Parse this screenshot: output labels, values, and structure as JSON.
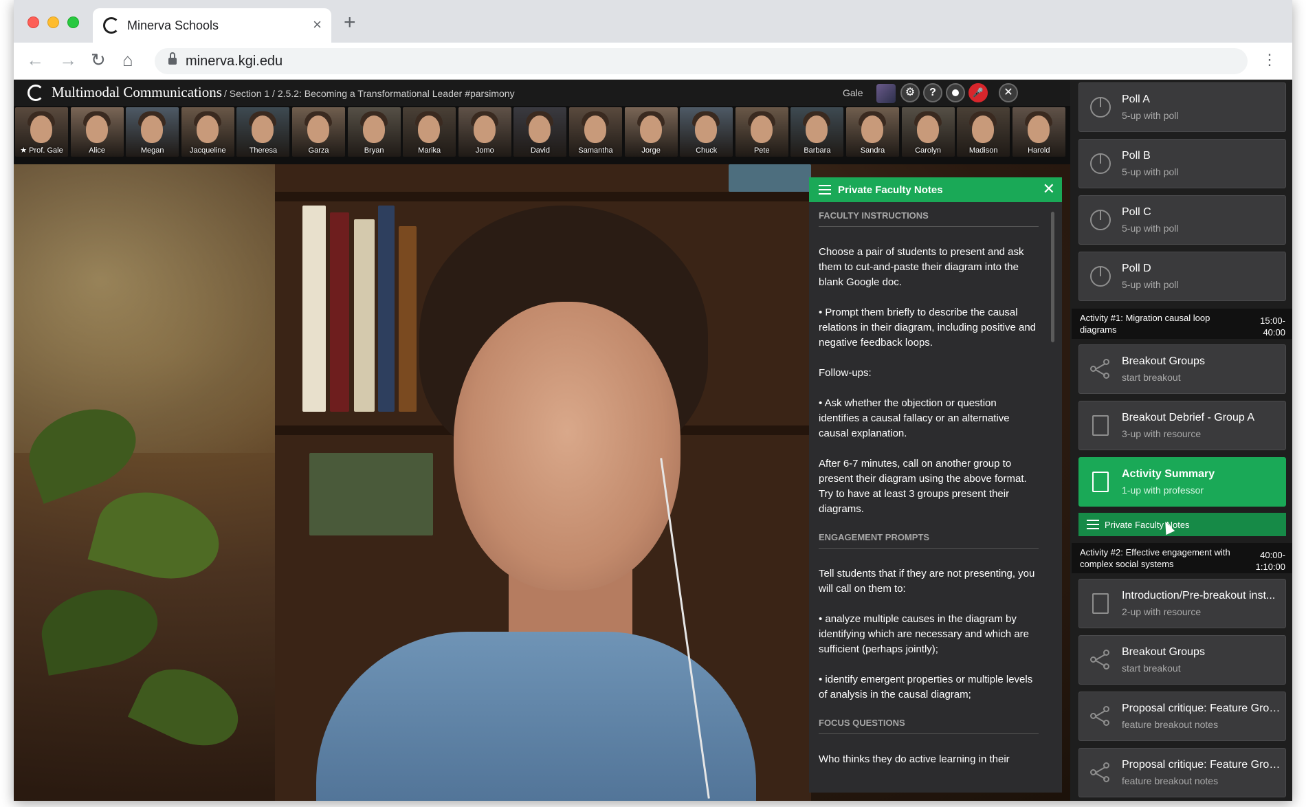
{
  "browser": {
    "tab_title": "Minerva Schools",
    "tab_close": "×",
    "new_tab": "+",
    "url": "minerva.kgi.edu",
    "back": "←",
    "forward": "→",
    "reload": "↻",
    "home": "⌂",
    "menu": "⋮"
  },
  "header": {
    "course": "Multimodal Communications",
    "breadcrumb": "/ Section 1 / 2.5.2: Becoming a Transformational Leader #parsimony",
    "host_name": "Gale",
    "buttons": {
      "settings": "⚙",
      "help": "?",
      "mic_muted": "🎤",
      "close": "✕"
    }
  },
  "participants": [
    "★ Prof. Gale",
    "Alice",
    "Megan",
    "Jacqueline",
    "Theresa",
    "Garza",
    "Bryan",
    "Marika",
    "Jomo",
    "David",
    "Samantha",
    "Jorge",
    "Chuck",
    "Pete",
    "Barbara",
    "Sandra",
    "Carolyn",
    "Madison",
    "Harold"
  ],
  "notes": {
    "title": "Private Faculty Notes",
    "close": "✕",
    "section_instructions": "FACULTY INSTRUCTIONS",
    "p1": "Choose a pair of students to present and ask them to cut-and-paste their diagram into the blank Google doc.",
    "p2": "• Prompt them briefly to describe the causal relations in their diagram, including positive and negative feedback loops.",
    "p3": "Follow-ups:",
    "p4": "• Ask whether the objection or question identifies a causal fallacy or an alternative causal explanation.",
    "p5": "After 6-7 minutes, call on another group to present their diagram using the above format. Try to have at least 3 groups present their diagrams.",
    "section_engagement": "ENGAGEMENT PROMPTS",
    "p6": "Tell students that if they are not presenting, you will call on them to:",
    "p7": "• analyze multiple causes in the diagram by identifying which are necessary and which are sufficient (perhaps jointly);",
    "p8": "• identify emergent properties or multiple levels of analysis in the causal diagram;",
    "section_focus": "FOCUS QUESTIONS",
    "p9": "Who thinks they do active learning in their"
  },
  "agenda": {
    "cards_top": [
      {
        "title": "Poll A",
        "sub": "5-up with poll",
        "icon": "pie-chart-icon"
      },
      {
        "title": "Poll B",
        "sub": "5-up with poll",
        "icon": "pie-chart-icon"
      },
      {
        "title": "Poll C",
        "sub": "5-up with poll",
        "icon": "pie-chart-icon"
      },
      {
        "title": "Poll D",
        "sub": "5-up with poll",
        "icon": "pie-chart-icon"
      }
    ],
    "activity1": {
      "name": "Activity #1: Migration causal loop diagrams",
      "time": "15:00-\n40:00"
    },
    "cards_mid": [
      {
        "title": "Breakout Groups",
        "sub": "start breakout",
        "icon": "share-icon"
      },
      {
        "title": "Breakout Debrief - Group A",
        "sub": "3-up with resource",
        "icon": "document-icon"
      },
      {
        "title": "Activity Summary",
        "sub": "1-up with professor",
        "icon": "document-icon"
      }
    ],
    "private_notes_label": "Private Faculty Notes",
    "activity2": {
      "name": "Activity #2: Effective engagement with complex social systems",
      "time": "40:00-\n1:10:00"
    },
    "cards_bottom": [
      {
        "title": "Introduction/Pre-breakout inst...",
        "sub": "2-up with resource",
        "icon": "document-icon"
      },
      {
        "title": "Breakout Groups",
        "sub": "start breakout",
        "icon": "share-icon"
      },
      {
        "title": "Proposal critique: Feature Grou...",
        "sub": "feature breakout notes",
        "icon": "share-icon"
      },
      {
        "title": "Proposal critique: Feature Grou...",
        "sub": "feature breakout notes",
        "icon": "share-icon"
      }
    ]
  },
  "colors": {
    "accent_green": "#1aa957",
    "mic_red": "#d8262c",
    "panel_dark": "#1e1e1e"
  }
}
